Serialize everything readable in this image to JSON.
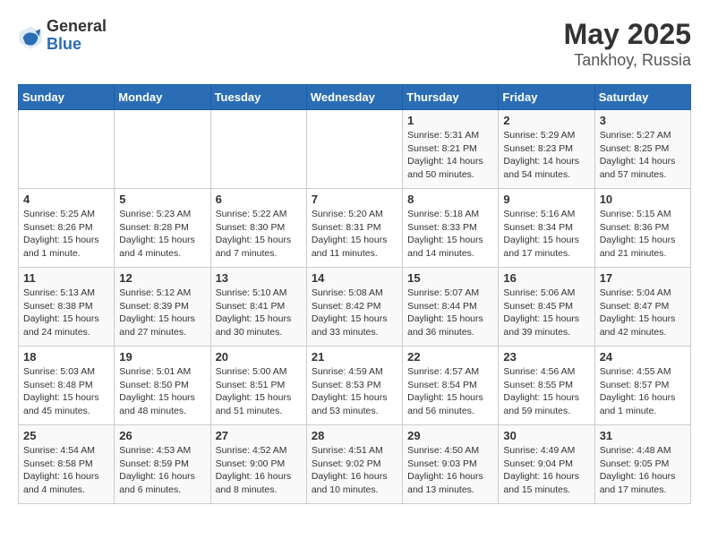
{
  "header": {
    "logo_general": "General",
    "logo_blue": "Blue",
    "title": "May 2025",
    "subtitle": "Tankhoy, Russia"
  },
  "weekdays": [
    "Sunday",
    "Monday",
    "Tuesday",
    "Wednesday",
    "Thursday",
    "Friday",
    "Saturday"
  ],
  "weeks": [
    [
      {
        "day": "",
        "detail": ""
      },
      {
        "day": "",
        "detail": ""
      },
      {
        "day": "",
        "detail": ""
      },
      {
        "day": "",
        "detail": ""
      },
      {
        "day": "1",
        "detail": "Sunrise: 5:31 AM\nSunset: 8:21 PM\nDaylight: 14 hours\nand 50 minutes."
      },
      {
        "day": "2",
        "detail": "Sunrise: 5:29 AM\nSunset: 8:23 PM\nDaylight: 14 hours\nand 54 minutes."
      },
      {
        "day": "3",
        "detail": "Sunrise: 5:27 AM\nSunset: 8:25 PM\nDaylight: 14 hours\nand 57 minutes."
      }
    ],
    [
      {
        "day": "4",
        "detail": "Sunrise: 5:25 AM\nSunset: 8:26 PM\nDaylight: 15 hours\nand 1 minute."
      },
      {
        "day": "5",
        "detail": "Sunrise: 5:23 AM\nSunset: 8:28 PM\nDaylight: 15 hours\nand 4 minutes."
      },
      {
        "day": "6",
        "detail": "Sunrise: 5:22 AM\nSunset: 8:30 PM\nDaylight: 15 hours\nand 7 minutes."
      },
      {
        "day": "7",
        "detail": "Sunrise: 5:20 AM\nSunset: 8:31 PM\nDaylight: 15 hours\nand 11 minutes."
      },
      {
        "day": "8",
        "detail": "Sunrise: 5:18 AM\nSunset: 8:33 PM\nDaylight: 15 hours\nand 14 minutes."
      },
      {
        "day": "9",
        "detail": "Sunrise: 5:16 AM\nSunset: 8:34 PM\nDaylight: 15 hours\nand 17 minutes."
      },
      {
        "day": "10",
        "detail": "Sunrise: 5:15 AM\nSunset: 8:36 PM\nDaylight: 15 hours\nand 21 minutes."
      }
    ],
    [
      {
        "day": "11",
        "detail": "Sunrise: 5:13 AM\nSunset: 8:38 PM\nDaylight: 15 hours\nand 24 minutes."
      },
      {
        "day": "12",
        "detail": "Sunrise: 5:12 AM\nSunset: 8:39 PM\nDaylight: 15 hours\nand 27 minutes."
      },
      {
        "day": "13",
        "detail": "Sunrise: 5:10 AM\nSunset: 8:41 PM\nDaylight: 15 hours\nand 30 minutes."
      },
      {
        "day": "14",
        "detail": "Sunrise: 5:08 AM\nSunset: 8:42 PM\nDaylight: 15 hours\nand 33 minutes."
      },
      {
        "day": "15",
        "detail": "Sunrise: 5:07 AM\nSunset: 8:44 PM\nDaylight: 15 hours\nand 36 minutes."
      },
      {
        "day": "16",
        "detail": "Sunrise: 5:06 AM\nSunset: 8:45 PM\nDaylight: 15 hours\nand 39 minutes."
      },
      {
        "day": "17",
        "detail": "Sunrise: 5:04 AM\nSunset: 8:47 PM\nDaylight: 15 hours\nand 42 minutes."
      }
    ],
    [
      {
        "day": "18",
        "detail": "Sunrise: 5:03 AM\nSunset: 8:48 PM\nDaylight: 15 hours\nand 45 minutes."
      },
      {
        "day": "19",
        "detail": "Sunrise: 5:01 AM\nSunset: 8:50 PM\nDaylight: 15 hours\nand 48 minutes."
      },
      {
        "day": "20",
        "detail": "Sunrise: 5:00 AM\nSunset: 8:51 PM\nDaylight: 15 hours\nand 51 minutes."
      },
      {
        "day": "21",
        "detail": "Sunrise: 4:59 AM\nSunset: 8:53 PM\nDaylight: 15 hours\nand 53 minutes."
      },
      {
        "day": "22",
        "detail": "Sunrise: 4:57 AM\nSunset: 8:54 PM\nDaylight: 15 hours\nand 56 minutes."
      },
      {
        "day": "23",
        "detail": "Sunrise: 4:56 AM\nSunset: 8:55 PM\nDaylight: 15 hours\nand 59 minutes."
      },
      {
        "day": "24",
        "detail": "Sunrise: 4:55 AM\nSunset: 8:57 PM\nDaylight: 16 hours\nand 1 minute."
      }
    ],
    [
      {
        "day": "25",
        "detail": "Sunrise: 4:54 AM\nSunset: 8:58 PM\nDaylight: 16 hours\nand 4 minutes."
      },
      {
        "day": "26",
        "detail": "Sunrise: 4:53 AM\nSunset: 8:59 PM\nDaylight: 16 hours\nand 6 minutes."
      },
      {
        "day": "27",
        "detail": "Sunrise: 4:52 AM\nSunset: 9:00 PM\nDaylight: 16 hours\nand 8 minutes."
      },
      {
        "day": "28",
        "detail": "Sunrise: 4:51 AM\nSunset: 9:02 PM\nDaylight: 16 hours\nand 10 minutes."
      },
      {
        "day": "29",
        "detail": "Sunrise: 4:50 AM\nSunset: 9:03 PM\nDaylight: 16 hours\nand 13 minutes."
      },
      {
        "day": "30",
        "detail": "Sunrise: 4:49 AM\nSunset: 9:04 PM\nDaylight: 16 hours\nand 15 minutes."
      },
      {
        "day": "31",
        "detail": "Sunrise: 4:48 AM\nSunset: 9:05 PM\nDaylight: 16 hours\nand 17 minutes."
      }
    ]
  ]
}
